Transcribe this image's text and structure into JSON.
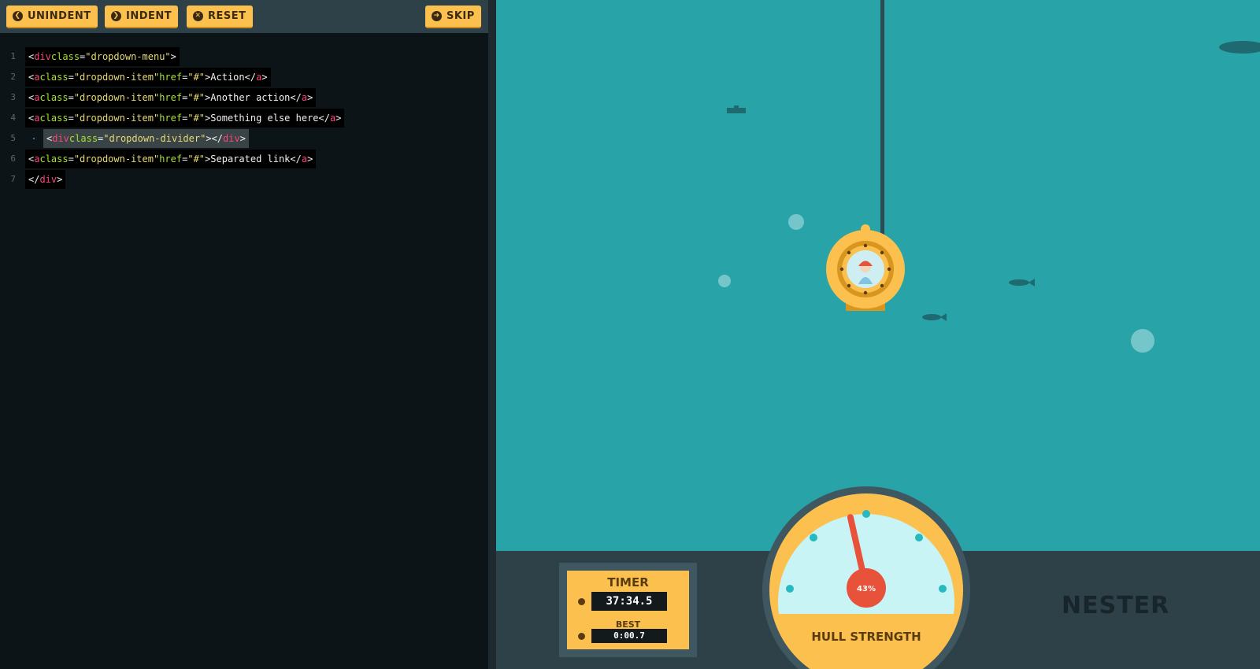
{
  "toolbar": {
    "unindent": "UNINDENT",
    "indent": "INDENT",
    "reset": "RESET",
    "skip": "SKIP"
  },
  "code_lines": [
    {
      "n": "1",
      "text": "<div class=\"dropdown-menu\">"
    },
    {
      "n": "2",
      "text": "<a class=\"dropdown-item\" href=\"#\">Action</a>"
    },
    {
      "n": "3",
      "text": "<a class=\"dropdown-item\" href=\"#\">Another action</a>"
    },
    {
      "n": "4",
      "text": "<a class=\"dropdown-item\" href=\"#\">Something else here</a>"
    },
    {
      "n": "5",
      "text": "<div class=\"dropdown-divider\"></div>"
    },
    {
      "n": "6",
      "text": "<a class=\"dropdown-item\" href=\"#\">Separated link</a>"
    },
    {
      "n": "7",
      "text": "</div>"
    }
  ],
  "timer": {
    "label": "TIMER",
    "value": "37:34.5",
    "best_label": "BEST",
    "best_value": "0:00.7"
  },
  "gauge": {
    "label": "HULL STRENGTH",
    "percent_text": "43%",
    "value": 0.43
  },
  "player_name": "NESTER",
  "colors": {
    "accent": "#fbc04e",
    "water": "#28a4a8",
    "panel": "#2e4148",
    "needle": "#e8523a"
  }
}
